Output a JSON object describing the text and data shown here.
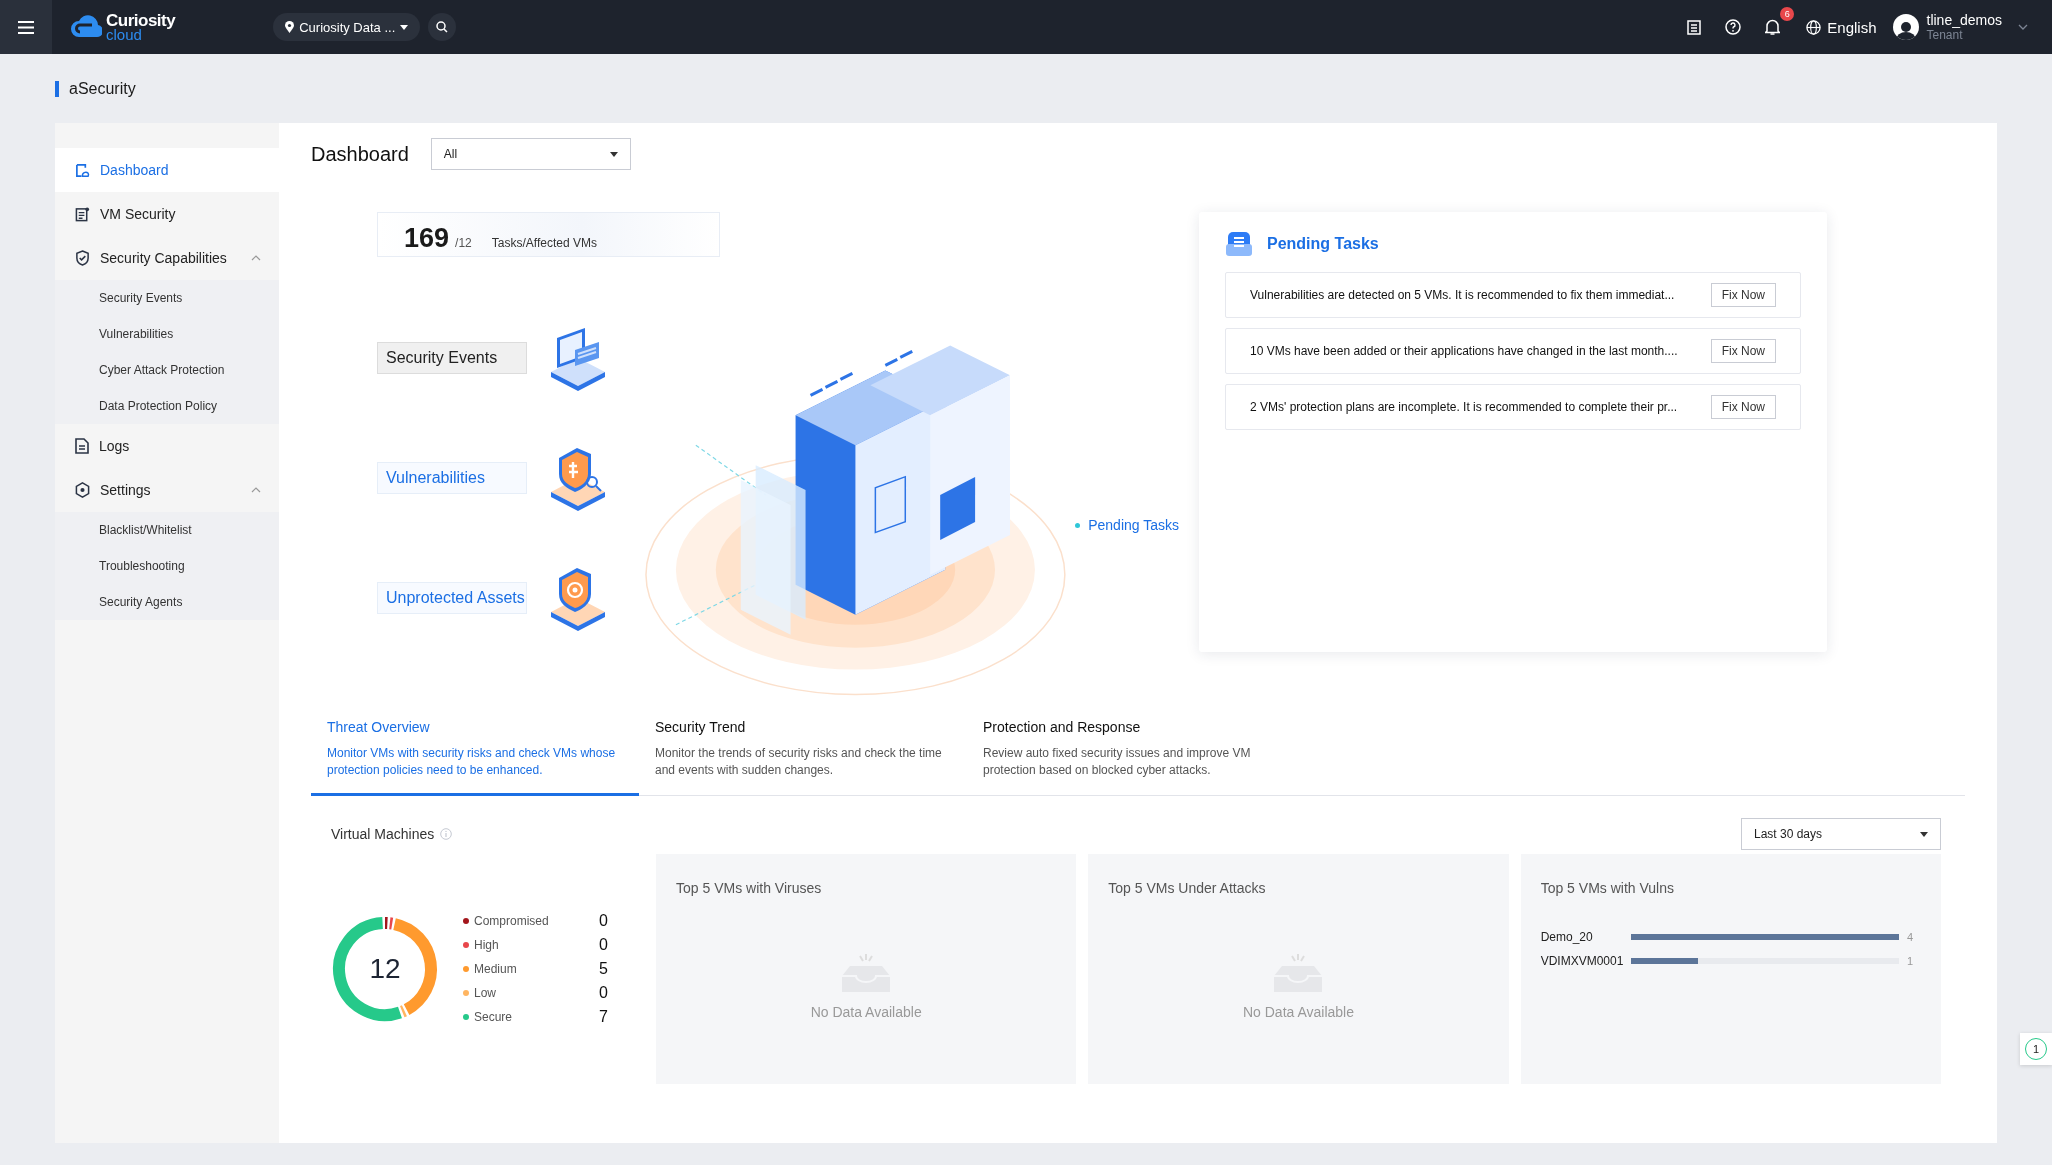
{
  "topbar": {
    "logo": {
      "name": "Curiosity",
      "sub": "cloud"
    },
    "region": "Curiosity Data ...",
    "notifications": "6",
    "language": "English",
    "user": {
      "name": "tline_demos",
      "role": "Tenant"
    }
  },
  "app_title": "aSecurity",
  "sidebar": {
    "items": [
      {
        "label": "Dashboard",
        "kind": "dashboard",
        "selected": true
      },
      {
        "label": "VM Security",
        "kind": "vm",
        "selected": false
      },
      {
        "label": "Security Capabilities",
        "kind": "shield",
        "selected": false,
        "expanded": true,
        "children": [
          {
            "label": "Security Events",
            "selected": false
          },
          {
            "label": "Vulnerabilities",
            "selected": false
          },
          {
            "label": "Cyber Attack Protection",
            "selected": false
          },
          {
            "label": "Data Protection Policy",
            "selected": false
          }
        ]
      },
      {
        "label": "Logs",
        "kind": "logs",
        "selected": false
      },
      {
        "label": "Settings",
        "kind": "gear",
        "selected": false,
        "expanded": true,
        "children": [
          {
            "label": "Blacklist/Whitelist",
            "selected": false
          },
          {
            "label": "Troubleshooting",
            "selected": false
          },
          {
            "label": "Security Agents",
            "selected": false
          }
        ]
      }
    ]
  },
  "dashboard": {
    "title": "Dashboard",
    "filter": "All",
    "stat": {
      "value": "169",
      "sub": "/12",
      "label": "Tasks/Affected VMs"
    },
    "features": [
      {
        "label": "Security Events",
        "kind": "laptop",
        "selected": true
      },
      {
        "label": "Vulnerabilities",
        "kind": "bug",
        "selected": false
      },
      {
        "label": "Unprotected Assets",
        "kind": "asset",
        "selected": false
      }
    ],
    "pending_label": "Pending Tasks",
    "pending": {
      "title": "Pending Tasks",
      "tasks": [
        {
          "text": "Vulnerabilities are detected on 5 VMs. It is recommended to fix them immediat...",
          "action": "Fix Now"
        },
        {
          "text": "10 VMs have been added or their applications have changed in the last month....",
          "action": "Fix Now"
        },
        {
          "text": "2 VMs' protection plans are incomplete. It is recommended to complete their pr...",
          "action": "Fix Now"
        }
      ]
    }
  },
  "tabs": [
    {
      "title": "Threat Overview",
      "description": "Monitor VMs with security risks and check VMs whose protection policies need to be enhanced.",
      "selected": true
    },
    {
      "title": "Security Trend",
      "description": "Monitor the trends of security risks and check the time and events with sudden changes.",
      "selected": false
    },
    {
      "title": "Protection and Response",
      "description": "Review auto fixed security issues and improve VM protection based on blocked cyber attacks.",
      "selected": false
    }
  ],
  "virtual_machines": {
    "title": "Virtual Machines",
    "period": "Last 30 days",
    "total": "12",
    "legend": [
      {
        "label": "Compromised",
        "color": "#a3161c",
        "count": "0"
      },
      {
        "label": "High",
        "color": "#e8474b",
        "count": "0"
      },
      {
        "label": "Medium",
        "color": "#ff9a2e",
        "count": "5"
      },
      {
        "label": "Low",
        "color": "#ffb561",
        "count": "0"
      },
      {
        "label": "Secure",
        "color": "#26c98a",
        "count": "7"
      }
    ]
  },
  "panels": [
    {
      "title": "Top 5 VMs with Viruses",
      "kind": "empty",
      "empty_text": "No Data Available"
    },
    {
      "title": "Top 5 VMs Under Attacks",
      "kind": "empty",
      "empty_text": "No Data Available"
    },
    {
      "title": "Top 5 VMs with Vulns",
      "kind": "bars",
      "rows": [
        {
          "name": "Demo_20",
          "value": "4",
          "level": 1
        },
        {
          "name": "VDIMXVM0001",
          "value": "1",
          "level": 0.25
        }
      ]
    }
  ],
  "float_badge": "1"
}
